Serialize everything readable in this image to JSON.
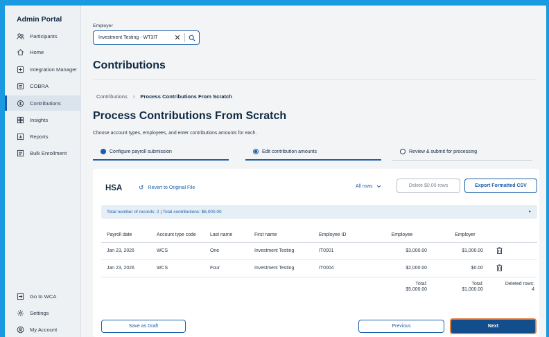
{
  "sidebar": {
    "brand": "Admin Portal",
    "items": [
      {
        "label": "Participants",
        "icon": "participants-icon"
      },
      {
        "label": "Home",
        "icon": "home-icon"
      },
      {
        "label": "Integration Manager",
        "icon": "integration-icon"
      },
      {
        "label": "COBRA",
        "icon": "cobra-icon"
      },
      {
        "label": "Contributions",
        "icon": "contributions-icon",
        "active": true
      },
      {
        "label": "Insights",
        "icon": "insights-icon"
      },
      {
        "label": "Reports",
        "icon": "reports-icon"
      },
      {
        "label": "Bulk Enrollment",
        "icon": "bulk-enrollment-icon"
      }
    ],
    "bottom_items": [
      {
        "label": "Go to WCA",
        "icon": "external-link-icon"
      },
      {
        "label": "Settings",
        "icon": "gear-icon"
      },
      {
        "label": "My Account",
        "icon": "account-icon"
      }
    ]
  },
  "employer": {
    "label": "Employer",
    "value": "Investment Testing - WT3IT"
  },
  "page_title": "Contributions",
  "breadcrumb": {
    "parent": "Contributions",
    "current": "Process Contributions From Scratch"
  },
  "section_title": "Process Contributions From Scratch",
  "intro": "Choose account types, employees, and enter contributions amounts for each.",
  "steps": [
    {
      "label": "Configure payroll submission",
      "state": "complete"
    },
    {
      "label": "Edit contribution amounts",
      "state": "current"
    },
    {
      "label": "Review & submit for processing",
      "state": "pending"
    }
  ],
  "account": {
    "title": "HSA",
    "revert_label": "Revert to Original File",
    "filter_label": "All rows",
    "delete_zero_label": "Delete $0.00 rows",
    "export_label": "Export Formatted CSV",
    "summary": "Total number of records: 2 | Total contributions: $6,000.00"
  },
  "table": {
    "headers": [
      "Payroll date",
      "Account type code",
      "Last name",
      "First name",
      "Employee ID",
      "Employee",
      "Employer"
    ],
    "rows": [
      [
        "Jan 23, 2026",
        "WCS",
        "One",
        "Investment Testing",
        "IT0001",
        "$3,000.00",
        "$1,000.00"
      ],
      [
        "Jan 23, 2026",
        "WCS",
        "Four",
        "Investment Testing",
        "IT0004",
        "$2,000.00",
        "$0.00"
      ]
    ],
    "totals": {
      "employee_label": "Total:",
      "employee_value": "$5,000.00",
      "employer_label": "Total:",
      "employer_value": "$1,000.00",
      "deleted_label": "Deleted rows:",
      "deleted_value": "4"
    }
  },
  "buttons": {
    "save_draft": "Save as Draft",
    "previous": "Previous",
    "next": "Next"
  },
  "colors": {
    "accent": "#1a5fa8",
    "primary_button": "#124e8c",
    "focus_ring": "#e8793a",
    "window_border": "#1a9ae0"
  }
}
